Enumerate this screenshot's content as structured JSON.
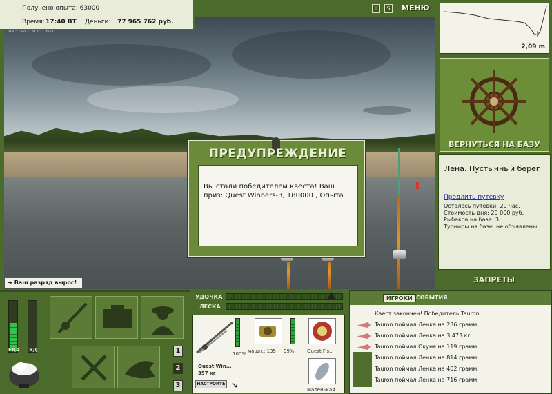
{
  "status": {
    "xp_label": "Получено опыта:",
    "xp_value": "63000",
    "time_label": "Время:",
    "time_value": "17:40 ВТ",
    "money_label": "Деньги:",
    "money_value": "77 965 762 руб."
  },
  "scene": {
    "watermark": "INSTALLSOFT.RU"
  },
  "toolbar": {
    "pause_label": "II",
    "sound_label": "S",
    "menu_label": "МЕНЮ"
  },
  "toast": {
    "rank_up": "Ваш разряд вырос!"
  },
  "modal": {
    "title": "ПРЕДУПРЕЖДЕНИЕ",
    "message": "Вы стали победителем квеста! Ваш приз: Quest Winners-3, 180000 , Опыта"
  },
  "depth": {
    "value": "2,09 m"
  },
  "base": {
    "return_label": "ВЕРНУТЬСЯ НА БАЗУ"
  },
  "location": {
    "title": "Лена. Пустынный берег",
    "extend_link": "Продлить путевку",
    "remaining": "Осталось путевки: 20 час.",
    "cost": "Стоимость дня: 29 000 руб.",
    "fishers": "Рыбаков на базе: 3",
    "tournaments": "Турниры на базе: не объявлены"
  },
  "bans": {
    "label": "ЗАПРЕТЫ"
  },
  "meters": {
    "food_label": "ЕДА",
    "poison_label": "ЯД",
    "food_level": 0.55,
    "poison_level": 0.0
  },
  "pages": [
    "1",
    "2",
    "3"
  ],
  "tackle": {
    "rod_label": "УДОЧКА",
    "line_label": "ЛЕСКА",
    "rod_name": "Quest Win...",
    "rod_weight": "357 кг",
    "rod_percent": "100%",
    "reel_power": "мощн.: 135",
    "reel_percent": "99%",
    "line_name": "Quest Fis...",
    "lure_name": "Маленькая",
    "setup_label": "НАСТРОИТЬ"
  },
  "log": {
    "tab_players": "ИГРОКИ",
    "tab_events": "СОБЫТИЯ",
    "lines": [
      "Квест закончен! Победитель Tauron",
      "Tauron поймал Ленка на 236 грамм",
      "Tauron поймал Ленка на 3,473 кг",
      "Tauron поймал Окуня на 119 грамм",
      "Tauron поймал Ленка на 814 грамм",
      "Tauron поймал Ленка на 402 грамм",
      "Tauron поймал Ленка на 716 грамм"
    ]
  }
}
